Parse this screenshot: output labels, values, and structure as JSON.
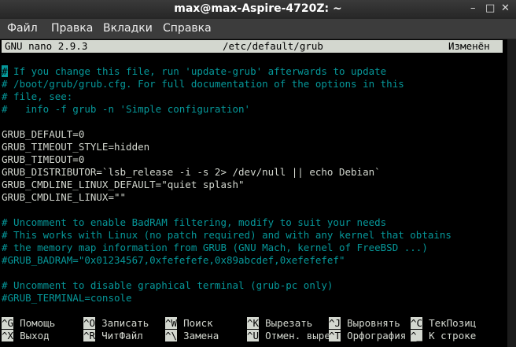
{
  "window": {
    "title": "max@max-Aspire-4720Z: ~",
    "controls": {
      "minimize": "–",
      "maximize": "□",
      "close": "✕"
    }
  },
  "menu": [
    "Файл",
    "Правка",
    "Вкладки",
    "Справка"
  ],
  "nano_header": {
    "version": "GNU nano 2.9.3",
    "file": "/etc/default/grub",
    "status": "Изменён"
  },
  "lines": [
    "# If you change this file, run 'update-grub' afterwards to update",
    "# /boot/grub/grub.cfg. For full documentation of the options in this",
    "# file, see:",
    "#   info -f grub -n 'Simple configuration'",
    "",
    "GRUB_DEFAULT=0",
    "GRUB_TIMEOUT_STYLE=hidden",
    "GRUB_TIMEOUT=0",
    "GRUB_DISTRIBUTOR=`lsb_release -i -s 2> /dev/null || echo Debian`",
    "GRUB_CMDLINE_LINUX_DEFAULT=\"quiet splash\"",
    "GRUB_CMDLINE_LINUX=\"\"",
    "",
    "# Uncomment to enable BadRAM filtering, modify to suit your needs",
    "# This works with Linux (no patch required) and with any kernel that obtains",
    "# the memory map information from GRUB (GNU Mach, kernel of FreeBSD ...)",
    "#GRUB_BADRAM=\"0x01234567,0xfefefefe,0x89abcdef,0xefefefef\"",
    "",
    "# Uncomment to disable graphical terminal (grub-pc only)",
    "#GRUB_TERMINAL=console"
  ],
  "shortcuts": [
    [
      {
        "key": "^G",
        "label": "Помощь"
      },
      {
        "key": "^O",
        "label": "Записать"
      },
      {
        "key": "^W",
        "label": "Поиск"
      },
      {
        "key": "^K",
        "label": "Вырезать"
      },
      {
        "key": "^J",
        "label": "Выровнять"
      },
      {
        "key": "^C",
        "label": "ТекПозиц"
      }
    ],
    [
      {
        "key": "^X",
        "label": "Выход"
      },
      {
        "key": "^R",
        "label": "ЧитФайл"
      },
      {
        "key": "^\\",
        "label": "Замена"
      },
      {
        "key": "^U",
        "label": "Отмен. вырез"
      },
      {
        "key": "^T",
        "label": "Орфография"
      },
      {
        "key": "^_",
        "label": "К строке"
      }
    ]
  ],
  "colors": {
    "comment": "#06989a",
    "text": "#d3d7cf",
    "background": "#000000",
    "titlebar": "#303030"
  }
}
